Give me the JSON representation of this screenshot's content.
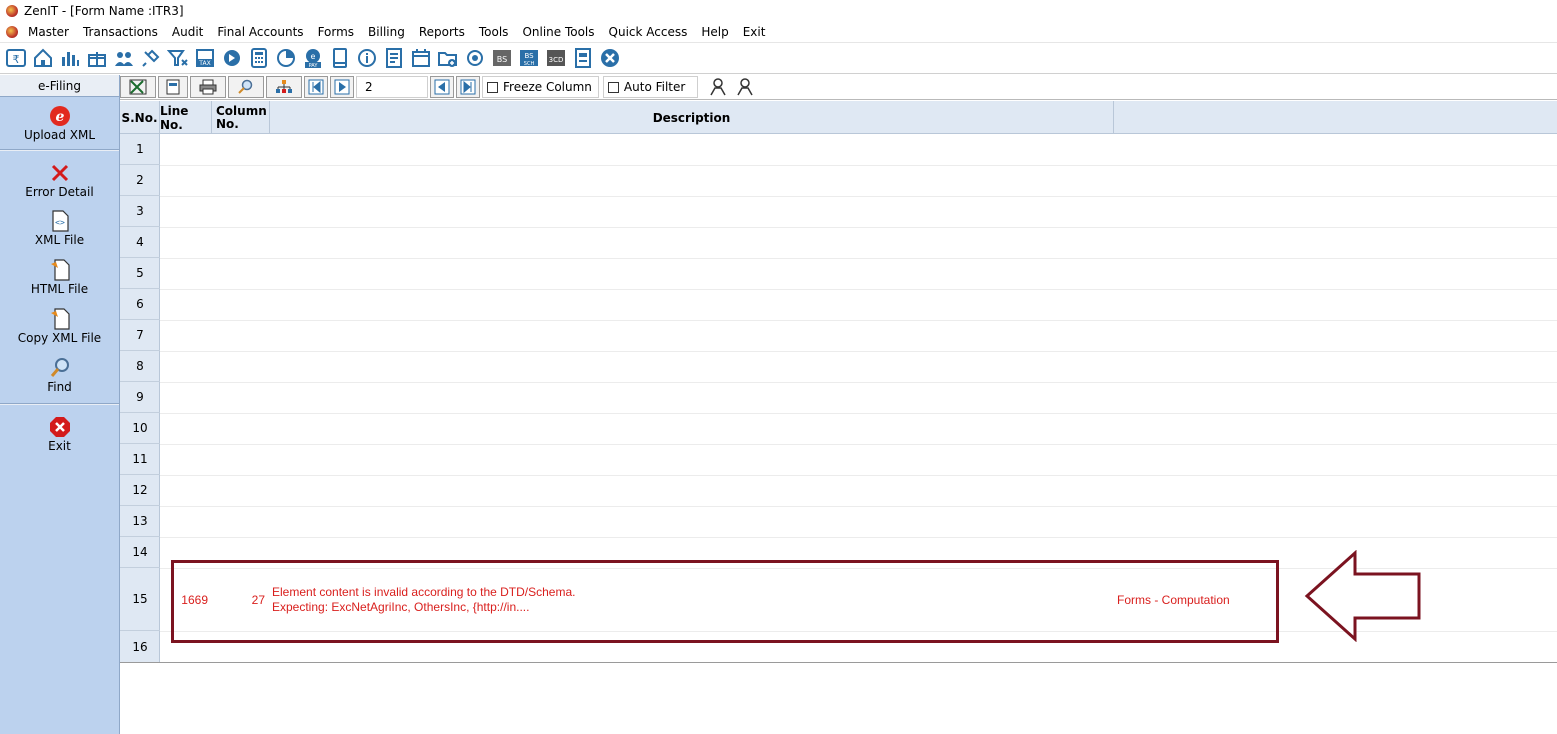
{
  "window": {
    "title": "ZenIT - [Form Name :ITR3]"
  },
  "menu": [
    "Master",
    "Transactions",
    "Audit",
    "Final Accounts",
    "Forms",
    "Billing",
    "Reports",
    "Tools",
    "Online Tools",
    "Quick Access",
    "Help",
    "Exit"
  ],
  "toolbar_icons": [
    "rupee-icon",
    "home-icon",
    "bar-chart-icon",
    "gift-icon",
    "users-icon",
    "pin-icon",
    "filter-icon",
    "tax-icon",
    "disc-icon",
    "calculator-icon",
    "pie-icon",
    "epay-icon",
    "book-icon",
    "info-icon",
    "report-icon",
    "calendar-icon",
    "folder-add-icon",
    "refresh-icon",
    "bs-icon",
    "bs-sch-icon",
    "3cd-icon",
    "form-icon",
    "close-circle-icon"
  ],
  "sidebar": {
    "header": "e-Filing",
    "items": [
      {
        "label": "Upload XML",
        "icon": "e-filing-icon"
      },
      {
        "label": "Error Detail",
        "icon": "red-x-icon"
      },
      {
        "label": "XML File",
        "icon": "xml-file-icon"
      },
      {
        "label": "HTML File",
        "icon": "html-file-icon"
      },
      {
        "label": "Copy XML File",
        "icon": "copy-file-icon"
      },
      {
        "label": "Find",
        "icon": "magnifier-icon"
      },
      {
        "label": "Exit",
        "icon": "exit-icon"
      }
    ]
  },
  "gridtool": {
    "record_value": "2",
    "freeze_column": "Freeze Column",
    "auto_filter": "Auto Filter"
  },
  "table": {
    "headers": {
      "sno": "S.No.",
      "line": "Line No.",
      "column": "Column No.",
      "description": "Description",
      "extra": ""
    },
    "row_numbers": [
      "1",
      "2",
      "3",
      "4",
      "5",
      "6",
      "7",
      "8",
      "9",
      "10",
      "11",
      "12",
      "13",
      "14",
      "15",
      "16"
    ],
    "error_row": {
      "line": "1669",
      "column": "27",
      "description_line1": "Element content is invalid according to the DTD/Schema.",
      "description_line2": "Expecting: ExcNetAgriInc, OthersInc, {http://in....",
      "section": "Forms - Computation"
    }
  },
  "colors": {
    "annotation": "#7b1320",
    "error_text": "#d9201e",
    "sidebar": "#bcd2ee",
    "header": "#dfe8f3"
  }
}
